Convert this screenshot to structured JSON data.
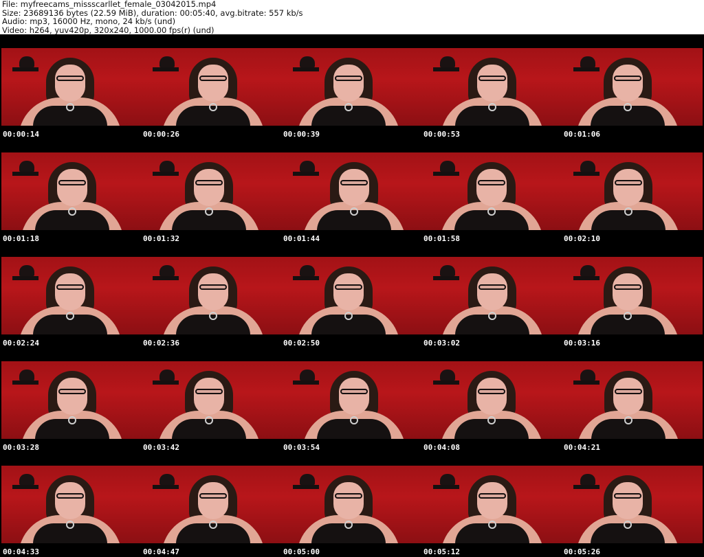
{
  "header": {
    "file_line": "File: myfreecams_missscarllet_female_03042015.mp4",
    "size_line": "Size: 23689136 bytes (22.59 MiB), duration: 00:05:40, avg.bitrate: 557 kb/s",
    "audio_line": "Audio: mp3, 16000 Hz, mono, 24 kb/s (und)",
    "video_line": "Video: h264, yuv420p, 320x240, 1000.00 fps(r) (und)"
  },
  "thumbnails": [
    {
      "timestamp": "00:00:14"
    },
    {
      "timestamp": "00:00:26"
    },
    {
      "timestamp": "00:00:39"
    },
    {
      "timestamp": "00:00:53"
    },
    {
      "timestamp": "00:01:06"
    },
    {
      "timestamp": "00:01:18"
    },
    {
      "timestamp": "00:01:32"
    },
    {
      "timestamp": "00:01:44"
    },
    {
      "timestamp": "00:01:58"
    },
    {
      "timestamp": "00:02:10"
    },
    {
      "timestamp": "00:02:24"
    },
    {
      "timestamp": "00:02:36"
    },
    {
      "timestamp": "00:02:50"
    },
    {
      "timestamp": "00:03:02"
    },
    {
      "timestamp": "00:03:16"
    },
    {
      "timestamp": "00:03:28"
    },
    {
      "timestamp": "00:03:42"
    },
    {
      "timestamp": "00:03:54"
    },
    {
      "timestamp": "00:04:08"
    },
    {
      "timestamp": "00:04:21"
    },
    {
      "timestamp": "00:04:33"
    },
    {
      "timestamp": "00:04:47"
    },
    {
      "timestamp": "00:05:00"
    },
    {
      "timestamp": "00:05:12"
    },
    {
      "timestamp": "00:05:26"
    }
  ],
  "colors": {
    "background": "#000000",
    "header_background": "#ffffff",
    "wall": "#a21216"
  }
}
